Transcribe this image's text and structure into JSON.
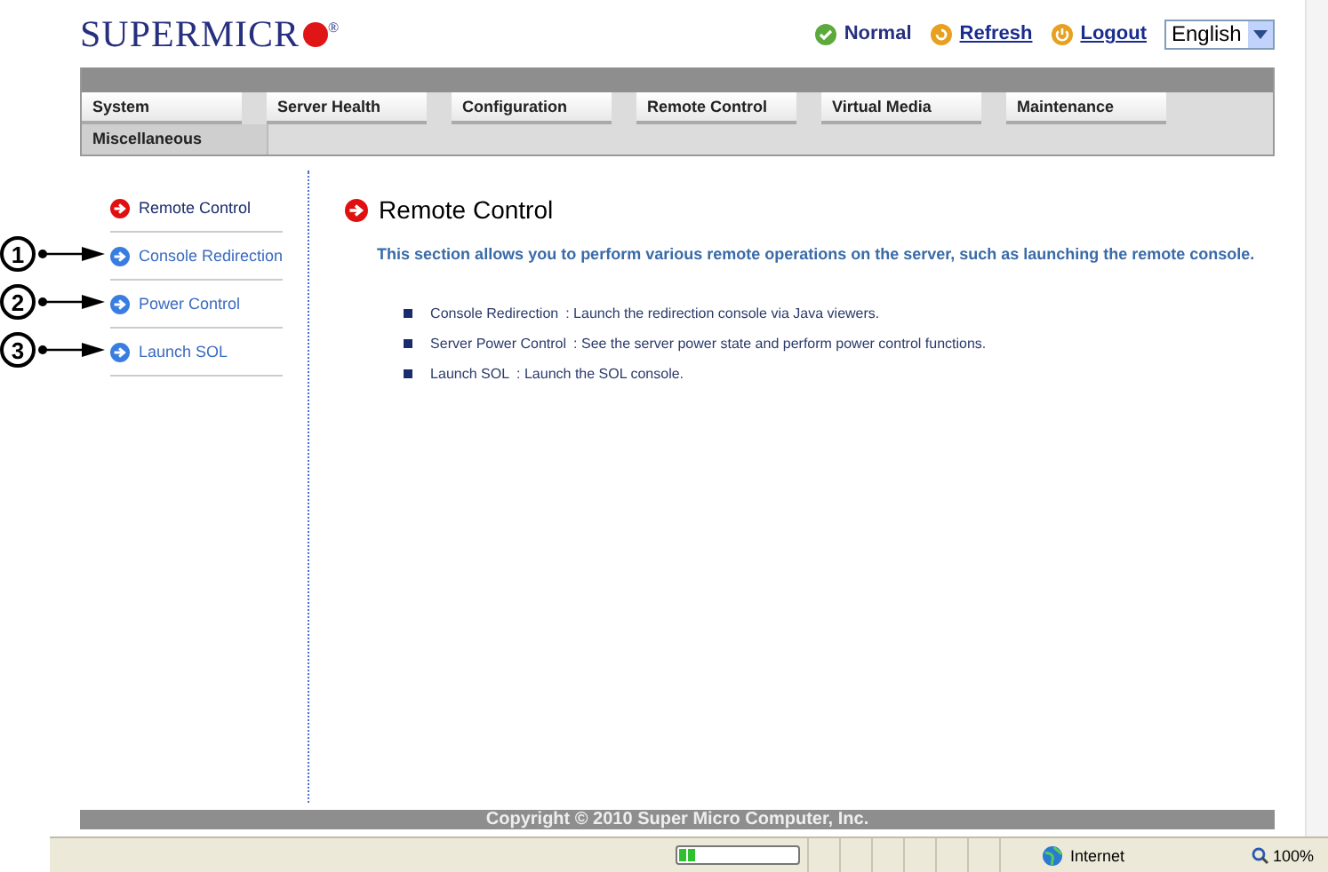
{
  "header": {
    "logo": "SUPERMICR",
    "logo_mark": "®",
    "status": "Normal",
    "links": [
      "Refresh",
      "Logout"
    ],
    "language": "English"
  },
  "nav": {
    "tabs": [
      {
        "label": "System"
      },
      {
        "label": "Server Health"
      },
      {
        "label": "Configuration"
      },
      {
        "label": "Remote Control"
      },
      {
        "label": "Virtual Media"
      },
      {
        "label": "Maintenance"
      },
      {
        "label": "Miscellaneous"
      }
    ]
  },
  "sidebar": {
    "items": [
      {
        "label": "Remote Control",
        "selected": true
      },
      {
        "label": "Console Redirection",
        "selected": false,
        "callout": "1"
      },
      {
        "label": "Power Control",
        "selected": false,
        "callout": "2"
      },
      {
        "label": "Launch SOL",
        "selected": false,
        "callout": "3"
      }
    ]
  },
  "content": {
    "title": "Remote Control",
    "intro": "This section allows you to perform various remote operations on the server, such as launching the remote console.",
    "bullets": [
      {
        "term": "Console Redirection",
        "text": ": Launch the redirection console via Java viewers."
      },
      {
        "term": "Server Power Control",
        "text": ": See the server power state and perform power control functions."
      },
      {
        "term": "Launch SOL",
        "text": ": Launch the SOL console."
      }
    ]
  },
  "footer": "Copyright © 2010 Super Micro Computer, Inc.",
  "status_bar": {
    "level": 0.15,
    "zone": "Internet",
    "zoom": "100%"
  }
}
